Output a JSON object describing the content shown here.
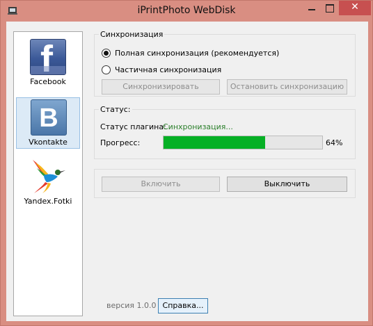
{
  "window": {
    "title": "iPrintPhoto WebDisk",
    "close_glyph": "✕"
  },
  "sidebar": {
    "items": [
      {
        "label": "Facebook",
        "logo_glyph": "f",
        "icon": "facebook-logo-icon",
        "color": "#3b5998"
      },
      {
        "label": "Vkontakte",
        "logo_glyph": "B",
        "icon": "vkontakte-logo-icon",
        "color": "#4a76a8",
        "selected": true
      },
      {
        "label": "Yandex.Fotki",
        "icon": "hummingbird-logo-icon"
      }
    ]
  },
  "sync": {
    "title": "Синхронизация",
    "full_label": "Полная синхронизация (рекомендуется)",
    "partial_label": "Частичная синхронизация",
    "selected": "full",
    "sync_button": "Синхронизировать",
    "stop_button": "Остановить синхронизацию"
  },
  "status": {
    "title": "Статус:",
    "plugin_label": "Статус плагина:",
    "plugin_value": "Синхронизация...",
    "progress_label": "Прогресс:",
    "progress_percent": 64,
    "progress_text": "64%",
    "progress_color": "#06b025"
  },
  "actions": {
    "enable_button": "Включить",
    "disable_button": "Выключить"
  },
  "footer": {
    "version": "версия 1.0.0",
    "help_button": "Справка..."
  }
}
